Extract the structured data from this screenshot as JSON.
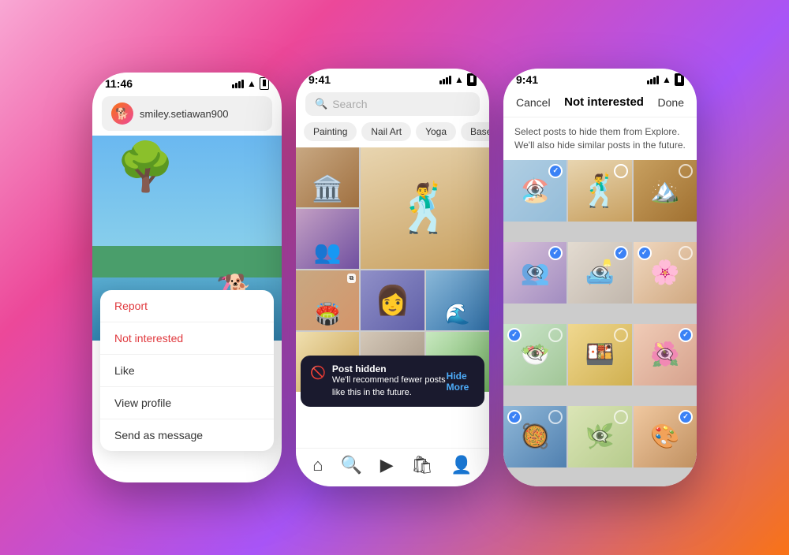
{
  "background": {
    "gradient": "linear-gradient(135deg, #f9a8d4 0%, #ec4899 25%, #a855f7 60%, #f97316 100%)"
  },
  "phone1": {
    "status_time": "11:46",
    "status_indicator": "◀",
    "username": "smiley.setiawan900",
    "menu_items": [
      {
        "label": "Report",
        "style": "red"
      },
      {
        "label": "Not interested",
        "style": "red"
      },
      {
        "label": "Like",
        "style": "normal"
      },
      {
        "label": "View profile",
        "style": "normal"
      },
      {
        "label": "Send as message",
        "style": "normal"
      }
    ]
  },
  "phone2": {
    "status_time": "9:41",
    "search_placeholder": "Search",
    "topics": [
      "Painting",
      "Nail Art",
      "Yoga",
      "Base"
    ],
    "toast": {
      "title": "Post hidden",
      "subtitle": "We'll recommend fewer posts like this in the future.",
      "action": "Hide More"
    },
    "nav_icons": [
      "home",
      "search",
      "reels",
      "shop",
      "profile"
    ]
  },
  "phone3": {
    "status_time": "9:41",
    "header": {
      "cancel": "Cancel",
      "title": "Not interested",
      "done": "Done"
    },
    "subtitle": "Select posts to hide them from Explore. We'll also hide similar posts in the future."
  }
}
